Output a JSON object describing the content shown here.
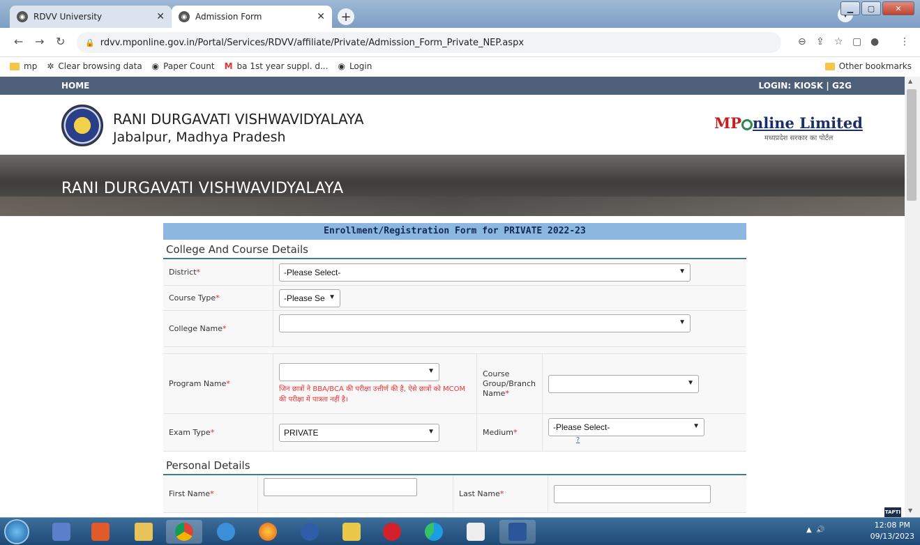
{
  "browser": {
    "tabs": [
      {
        "title": "RDVV University",
        "active": false
      },
      {
        "title": "Admission Form",
        "active": true
      }
    ],
    "url": "rdvv.mponline.gov.in/Portal/Services/RDVV/affiliate/Private/Admission_Form_Private_NEP.aspx",
    "bookmarks": [
      "mp",
      "Clear browsing data",
      "Paper Count",
      "ba 1st year suppl. d...",
      "Login"
    ],
    "other_bookmarks": "Other bookmarks"
  },
  "site": {
    "nav_home": "HOME",
    "nav_login": "LOGIN: KIOSK | G2G",
    "univ_name": "RANI DURGAVATI VISHWAVIDYALAYA",
    "univ_place": "Jabalpur, Madhya Pradesh",
    "mp_logo": "MPOnline Limited",
    "mp_logo_sub": "मध्यप्रदेश सरकार का पोर्टल",
    "banner_title": "RANI DURGAVATI VISHWAVIDYALAYA"
  },
  "form": {
    "title": "Enrollment/Registration Form for PRIVATE 2022-23",
    "section1": "College And Course Details",
    "district_label": "District",
    "district_value": "-Please Select-",
    "course_type_label": "Course Type",
    "course_type_value": "-Please Se",
    "college_label": "College Name",
    "college_value": "",
    "program_label": "Program Name",
    "program_value": "",
    "program_warning": "जिन छात्रों ने BBA/BCA की परीक्षा उत्तीर्ण की है, ऐसे छात्रों को MCOM की परीक्षा में पात्रता नहीं है।",
    "course_group_label": "Course Group/Branch Name",
    "course_group_value": "",
    "exam_type_label": "Exam Type",
    "exam_type_value": "PRIVATE",
    "medium_label": "Medium",
    "medium_value": "-Please Select-",
    "medium_hint": "?",
    "section2": "Personal Details",
    "first_name_label": "First Name",
    "last_name_label": "Last Name ",
    "required_mark": "*"
  },
  "misc": {
    "tapti": "TAPTI"
  },
  "taskbar": {
    "time": "12:08 PM",
    "date": "09/13/2023"
  }
}
